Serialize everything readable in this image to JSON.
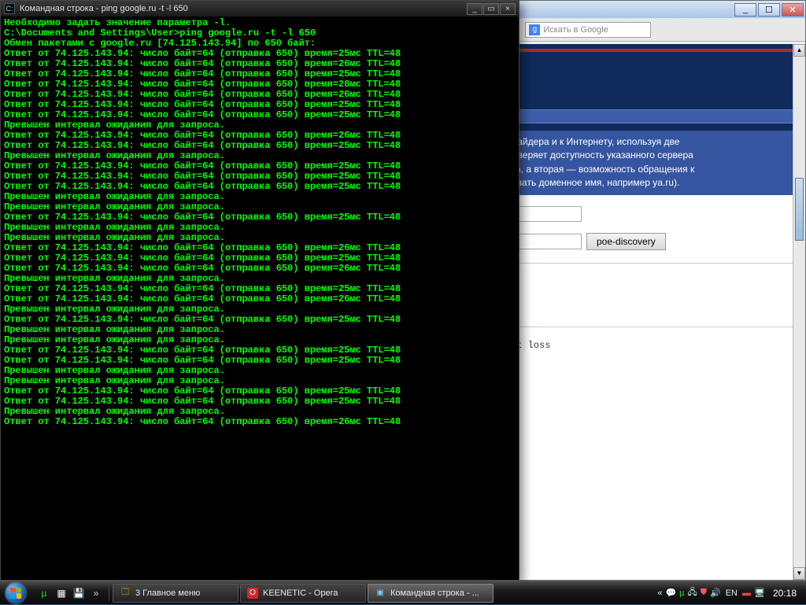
{
  "cmd": {
    "title": "Командная строка - ping google.ru -t -l 650",
    "lines": [
      "Необходимо задать значение параметра -l.",
      "",
      "C:\\Documents and Settings\\User>ping google.ru -t -l 650",
      "",
      "Обмен пакетами с google.ru [74.125.143.94] по 650 байт:",
      "",
      "Ответ от 74.125.143.94: число байт=64 (отправка 650) время=25мс TTL=48",
      "Ответ от 74.125.143.94: число байт=64 (отправка 650) время=26мс TTL=48",
      "Ответ от 74.125.143.94: число байт=64 (отправка 650) время=25мс TTL=48",
      "Ответ от 74.125.143.94: число байт=64 (отправка 650) время=28мс TTL=48",
      "Ответ от 74.125.143.94: число байт=64 (отправка 650) время=26мс TTL=48",
      "Ответ от 74.125.143.94: число байт=64 (отправка 650) время=25мс TTL=48",
      "Ответ от 74.125.143.94: число байт=64 (отправка 650) время=25мс TTL=48",
      "Превышен интервал ожидания для запроса.",
      "Ответ от 74.125.143.94: число байт=64 (отправка 650) время=26мс TTL=48",
      "Ответ от 74.125.143.94: число байт=64 (отправка 650) время=25мс TTL=48",
      "Превышен интервал ожидания для запроса.",
      "Ответ от 74.125.143.94: число байт=64 (отправка 650) время=25мс TTL=48",
      "Ответ от 74.125.143.94: число байт=64 (отправка 650) время=25мс TTL=48",
      "Ответ от 74.125.143.94: число байт=64 (отправка 650) время=25мс TTL=48",
      "Превышен интервал ожидания для запроса.",
      "Превышен интервал ожидания для запроса.",
      "Ответ от 74.125.143.94: число байт=64 (отправка 650) время=25мс TTL=48",
      "Превышен интервал ожидания для запроса.",
      "Превышен интервал ожидания для запроса.",
      "Ответ от 74.125.143.94: число байт=64 (отправка 650) время=26мс TTL=48",
      "Ответ от 74.125.143.94: число байт=64 (отправка 650) время=25мс TTL=48",
      "Ответ от 74.125.143.94: число байт=64 (отправка 650) время=26мс TTL=48",
      "Превышен интервал ожидания для запроса.",
      "Ответ от 74.125.143.94: число байт=64 (отправка 650) время=25мс TTL=48",
      "Ответ от 74.125.143.94: число байт=64 (отправка 650) время=26мс TTL=48",
      "Превышен интервал ожидания для запроса.",
      "Ответ от 74.125.143.94: число байт=64 (отправка 650) время=25мс TTL=48",
      "Превышен интервал ожидания для запроса.",
      "Превышен интервал ожидания для запроса.",
      "Ответ от 74.125.143.94: число байт=64 (отправка 650) время=25мс TTL=48",
      "Ответ от 74.125.143.94: число байт=64 (отправка 650) время=25мс TTL=48",
      "Превышен интервал ожидания для запроса.",
      "Превышен интервал ожидания для запроса.",
      "Ответ от 74.125.143.94: число байт=64 (отправка 650) время=25мс TTL=48",
      "Ответ от 74.125.143.94: число байт=64 (отправка 650) время=25мс TTL=48",
      "Превышен интервал ожидания для запроса.",
      "Ответ от 74.125.143.94: число байт=64 (отправка 650) время=26мс TTL=48",
      ""
    ]
  },
  "browser": {
    "search_placeholder": "Искать в Google",
    "info_lines": [
      "вайдера и к Интернету, используя две",
      "оверяет доступность указанного сервера",
      "а), а вторая — возможность обращения к",
      "азать доменное имя, например ya.ru)."
    ],
    "button_label": "poe-discovery",
    "partial_text": "et loss"
  },
  "taskbar": {
    "items": [
      {
        "label": "3 Главное меню",
        "icon": "🗔"
      },
      {
        "label": "KEENETIC - Opera",
        "icon": "O"
      },
      {
        "label": "Командная строка - ...",
        "icon": "▣"
      }
    ],
    "lang": "EN",
    "clock": "20:18"
  }
}
